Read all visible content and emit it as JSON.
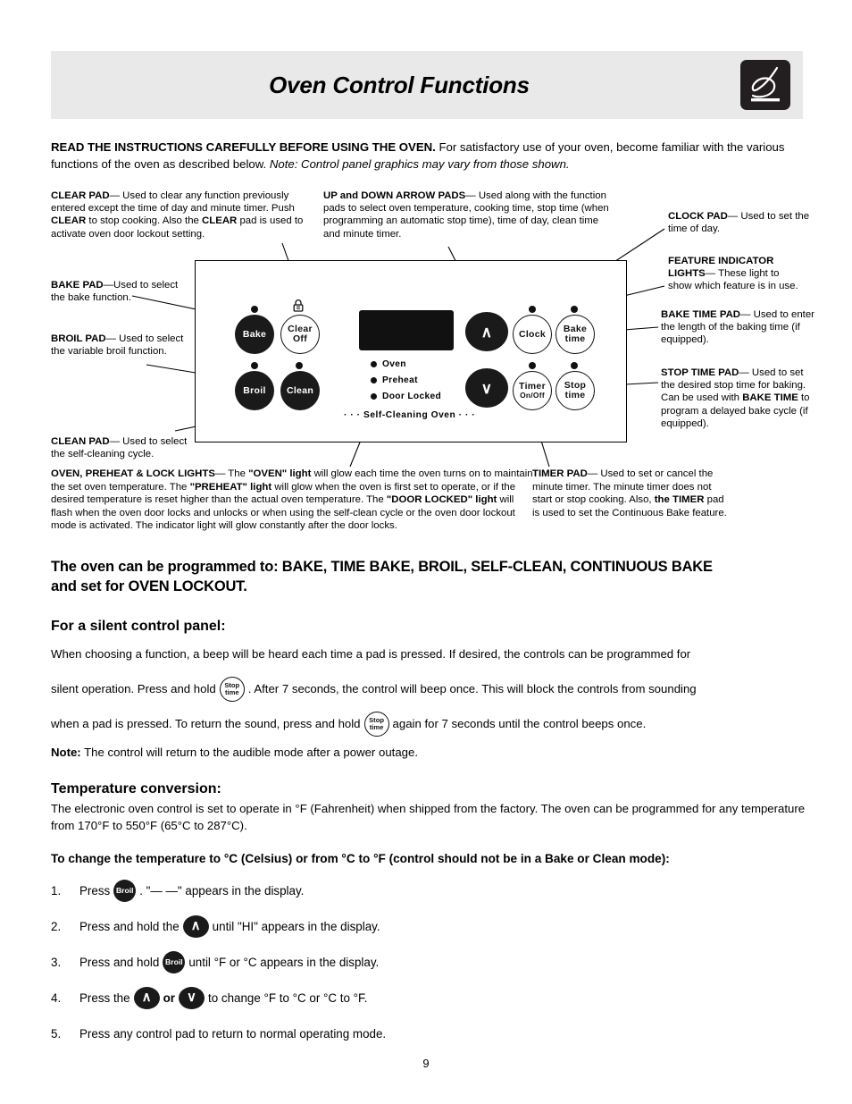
{
  "header": {
    "title": "Oven Control Functions",
    "logo_name": "flame-logo"
  },
  "intro": {
    "bold_lead": "READ THE INSTRUCTIONS CAREFULLY BEFORE USING THE OVEN.",
    "rest": " For satisfactory use of your oven, become familiar with the various functions of the oven as described below. ",
    "italic_note": "Note: Control panel graphics may vary from those shown."
  },
  "callouts": {
    "clear_pad": {
      "title": "CLEAR PAD",
      "text_1": "— Used to clear any function previously entered except the time of day and minute timer. Push ",
      "bold_2": "CLEAR",
      "text_3": " to stop cooking. Also the ",
      "bold_4": "CLEAR",
      "text_5": " pad is used to activate oven door lockout setting."
    },
    "bake_pad": {
      "title": "BAKE PAD",
      "text": "—Used to select the bake function."
    },
    "broil_pad": {
      "title": "BROIL PAD",
      "text": "— Used to select the variable broil function."
    },
    "clean_pad": {
      "title": "CLEAN PAD",
      "text": "— Used to select the self-cleaning cycle."
    },
    "up_down_pads": {
      "title": "UP and DOWN ARROW PADS",
      "text": "— Used along with the function pads to select oven temperature, cooking time, stop time (when programming an automatic stop time), time of day, clean time and minute timer."
    },
    "clock_pad": {
      "title": "CLOCK PAD",
      "text": "— Used to set the time of day."
    },
    "feature_lights": {
      "title": "FEATURE INDICATOR LIGHTS",
      "text": "— These light to show which feature is in use."
    },
    "bake_time_pad": {
      "title": "BAKE TIME PAD",
      "text": "— Used to enter the length of the baking time (if equipped)."
    },
    "stop_time_pad": {
      "title": "STOP TIME PAD",
      "text_1": "— Used to set the desired stop time for baking. Can be used with ",
      "bold_2": "BAKE TIME",
      "text_3": " to program a delayed bake cycle (if equipped)."
    },
    "lights": {
      "title": "OVEN, PREHEAT & LOCK LIGHTS",
      "t1": "— The ",
      "b1": "\"OVEN\" light",
      "t2": " will glow each time the oven turns on to maintain the set oven temperature. The ",
      "b2": "\"PREHEAT\" light",
      "t3": " will glow when the oven is first set to operate, or if the desired temperature is reset higher than the actual oven temperature. The ",
      "b3": "\"DOOR LOCKED\" light",
      "t4": " will flash when the oven door locks and unlocks or when using the self-clean cycle or the oven door lockout mode is activated. The indicator light will glow constantly after the door locks."
    },
    "timer_pad": {
      "title": "TIMER PAD",
      "t1": "— Used to set or cancel the minute timer. The minute timer does not start or stop cooking. Also, ",
      "b1": "the TIMER",
      "t2": " pad is used to set the Continuous Bake feature."
    }
  },
  "panel": {
    "pads": {
      "bake": "Bake",
      "clear_l1": "Clear",
      "clear_l2": "Off",
      "broil": "Broil",
      "clean": "Clean",
      "up_arrow": "∧",
      "down_arrow": "∨",
      "clock": "Clock",
      "bake_time_l1": "Bake",
      "bake_time_l2": "time",
      "timer_l1": "Timer",
      "timer_l2": "On/Off",
      "stop_time_l1": "Stop",
      "stop_time_l2": "time"
    },
    "indicators": [
      "Oven",
      "Preheat",
      "Door Locked"
    ],
    "brand_label": "·  ·  ·  Self-Cleaning Oven  ·  ·  ·",
    "lock_icon_name": "padlock-icon"
  },
  "body": {
    "programmed_line1": "The oven can be programmed to: BAKE, TIME BAKE, BROIL, SELF-CLEAN, CONTINUOUS BAKE",
    "programmed_line2": "and set for OVEN LOCKOUT.",
    "silent_heading": "For a silent control panel:",
    "silent_p1": "When choosing a function, a beep will be heard each time a pad is pressed. If desired, the controls can be programmed for",
    "silent_p2_a": "silent operation. Press and hold",
    "silent_p2_b": ". After 7 seconds, the control will beep once. This will block the controls from sounding",
    "silent_p3_a": "when a pad is pressed. To return the sound, press and hold",
    "silent_p3_b": "again for 7 seconds until the control beeps once.",
    "note_label": "Note:",
    "note_text": " The control will return to the audible mode after a power outage.",
    "temp_heading": "Temperature conversion:",
    "temp_p": "The electronic oven control is set to operate in °F (Fahrenheit) when shipped from the factory. The oven can be programmed for any temperature from 170°F to 550°F (65°C to 287°C).",
    "change_heading": "To change the temperature to °C (Celsius) or from °C to °F (control should not be in a Bake or Clean mode):"
  },
  "steps": [
    {
      "num": "1.",
      "a": "Press",
      "b": ". \"— —\" appears in the display.",
      "c": ""
    },
    {
      "num": "2.",
      "a": "Press and hold the",
      "b": "until \"HI\" appears in the display.",
      "c": ""
    },
    {
      "num": "3.",
      "a": "Press and hold",
      "b": "until °F or °C appears in the display.",
      "c": ""
    },
    {
      "num": "4.",
      "a": "Press the",
      "b": "or",
      "c": "to change °F to °C or °C to °F."
    },
    {
      "num": "5.",
      "a": "Press any control pad to return to normal operating mode.",
      "b": "",
      "c": ""
    }
  ],
  "inline_pads": {
    "stop_l1": "Stop",
    "stop_l2": "time",
    "broil": "Broil",
    "up": "∧",
    "down": "∨"
  },
  "page_number": "9",
  "colors": {
    "header_bg": "#e9e9e9",
    "pad_dark": "#1a1a1a",
    "ink": "#000000"
  }
}
